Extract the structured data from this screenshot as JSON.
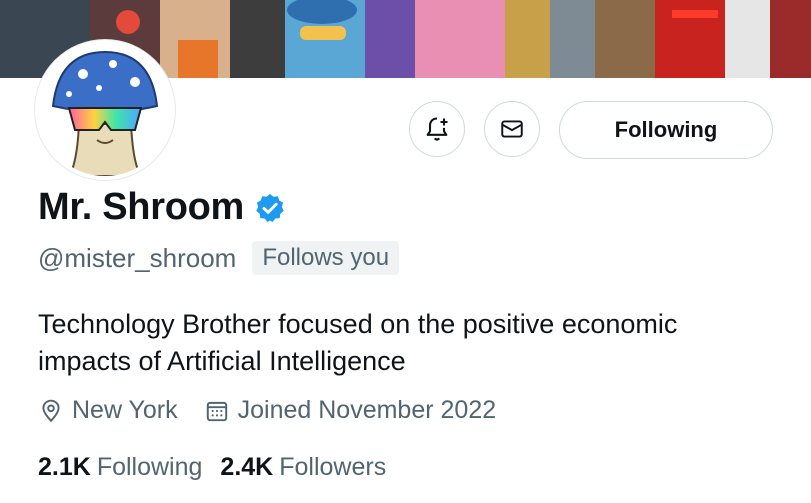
{
  "profile": {
    "display_name": "Mr. Shroom",
    "handle": "@mister_shroom",
    "follows_you_badge": "Follows you",
    "bio_line1": "Technology Brother focused on the positive economic",
    "bio_line2": "impacts of Artificial Intelligence",
    "location": "New York",
    "joined": "Joined November 2022",
    "verified": true
  },
  "actions": {
    "notify_icon": "bell-plus-icon",
    "message_icon": "envelope-icon",
    "following_label": "Following"
  },
  "stats": {
    "following_count": "2.1K",
    "following_label": "Following",
    "followers_count": "2.4K",
    "followers_label": "Followers"
  },
  "colors": {
    "verified_blue": "#1d9bf0",
    "secondary_text": "#536471",
    "primary_text": "#0f1419",
    "border": "#cfd9de"
  }
}
